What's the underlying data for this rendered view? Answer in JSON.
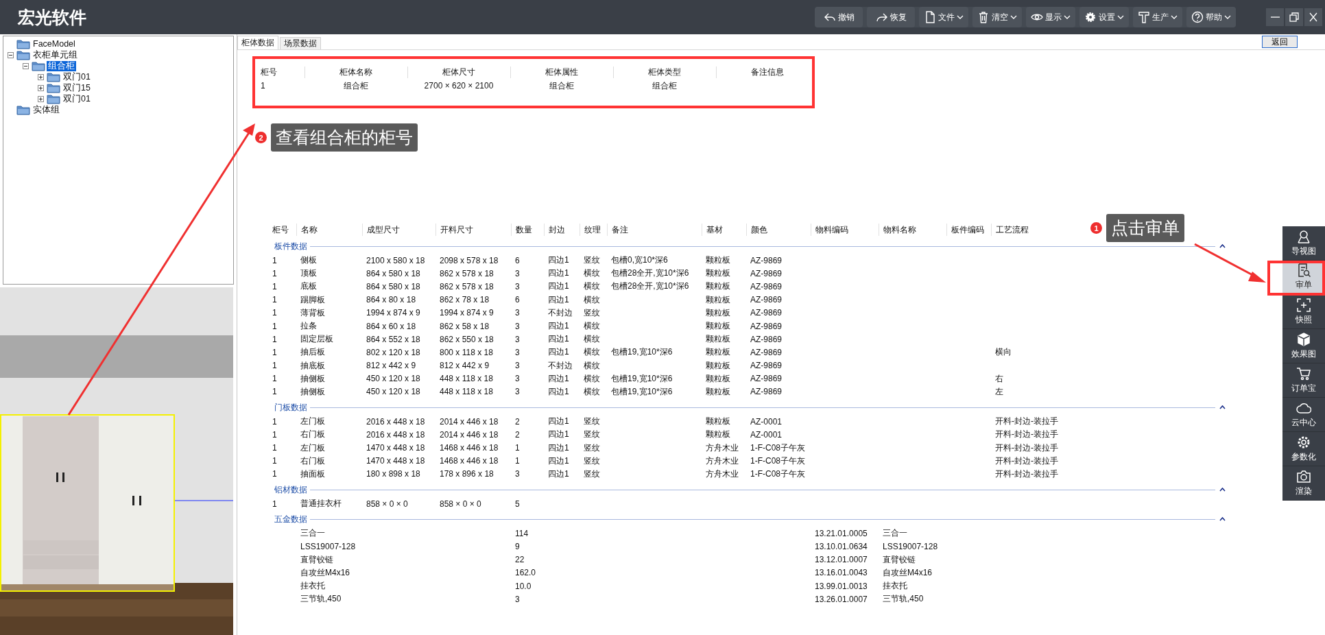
{
  "app_title": "宏光软件",
  "toolbar": [
    {
      "label": "撤销",
      "dropdown": false
    },
    {
      "label": "恢复",
      "dropdown": false
    },
    {
      "label": "文件",
      "dropdown": true
    },
    {
      "label": "清空",
      "dropdown": true
    },
    {
      "label": "显示",
      "dropdown": true
    },
    {
      "label": "设置",
      "dropdown": true
    },
    {
      "label": "生产",
      "dropdown": true
    },
    {
      "label": "帮助",
      "dropdown": true
    }
  ],
  "tree": [
    {
      "label": "FaceModel",
      "selected": false
    },
    {
      "label": "衣柜单元组",
      "selected": false,
      "expanded": true,
      "children": [
        {
          "label": "组合柜",
          "selected": true,
          "expanded": true,
          "children": [
            {
              "label": "双门01",
              "selected": false,
              "expanded": false
            },
            {
              "label": "双门15",
              "selected": false,
              "expanded": false
            },
            {
              "label": "双门01",
              "selected": false,
              "expanded": false
            }
          ]
        }
      ]
    },
    {
      "label": "实体组",
      "selected": false
    }
  ],
  "tabs": [
    {
      "label": "柜体数据",
      "selected": true
    },
    {
      "label": "场景数据",
      "selected": false
    }
  ],
  "back_button": "返回",
  "summary": {
    "columns": [
      "柜号",
      "柜体名称",
      "柜体尺寸",
      "柜体属性",
      "柜体类型",
      "备注信息"
    ],
    "rows": [
      [
        "1",
        "组合柜",
        "2700 × 620 × 2100",
        "组合柜",
        "组合柜"
      ]
    ]
  },
  "detail": {
    "columns": [
      "柜号",
      "名称",
      "成型尺寸",
      "开料尺寸",
      "数量",
      "封边",
      "纹理",
      "备注",
      "基材",
      "颜色",
      "物料编码",
      "物料名称",
      "板件编码",
      "工艺流程"
    ],
    "sections": [
      {
        "title": "板件数据",
        "expanded": true,
        "rows": [
          {
            "cabinet_no": "1",
            "name": "侧板",
            "formed_size": "2100 x 580 x 18",
            "cut_size": "2098 x 578 x 18",
            "qty": "6",
            "edge": "四边1",
            "grain": "竖纹",
            "note": "包槽0,宽10*深6",
            "base": "颗粒板",
            "color_code": "AZ-9869"
          },
          {
            "cabinet_no": "1",
            "name": "顶板",
            "formed_size": "864 x 580 x 18",
            "cut_size": "862 x 578 x 18",
            "qty": "3",
            "edge": "四边1",
            "grain": "横纹",
            "note": "包槽28全开,宽10*深6",
            "base": "颗粒板",
            "color_code": "AZ-9869"
          },
          {
            "cabinet_no": "1",
            "name": "底板",
            "formed_size": "864 x 580 x 18",
            "cut_size": "862 x 578 x 18",
            "qty": "3",
            "edge": "四边1",
            "grain": "横纹",
            "note": "包槽28全开,宽10*深6",
            "base": "颗粒板",
            "color_code": "AZ-9869"
          },
          {
            "cabinet_no": "1",
            "name": "踢脚板",
            "formed_size": "864 x 80 x 18",
            "cut_size": "862 x 78 x 18",
            "qty": "6",
            "edge": "四边1",
            "grain": "横纹",
            "base": "颗粒板",
            "color_code": "AZ-9869"
          },
          {
            "cabinet_no": "1",
            "name": "薄背板",
            "formed_size": "1994 x 874 x 9",
            "cut_size": "1994 x 874 x 9",
            "qty": "3",
            "edge": "不封边",
            "grain": "竖纹",
            "base": "颗粒板",
            "color_code": "AZ-9869"
          },
          {
            "cabinet_no": "1",
            "name": "拉条",
            "formed_size": "864 x 60 x 18",
            "cut_size": "862 x 58 x 18",
            "qty": "3",
            "edge": "四边1",
            "grain": "横纹",
            "base": "颗粒板",
            "color_code": "AZ-9869"
          },
          {
            "cabinet_no": "1",
            "name": "固定层板",
            "formed_size": "864 x 552 x 18",
            "cut_size": "862 x 550 x 18",
            "qty": "3",
            "edge": "四边1",
            "grain": "横纹",
            "base": "颗粒板",
            "color_code": "AZ-9869"
          },
          {
            "cabinet_no": "1",
            "name": "抽后板",
            "formed_size": "802 x 120 x 18",
            "cut_size": "800 x 118 x 18",
            "qty": "3",
            "edge": "四边1",
            "grain": "横纹",
            "note": "包槽19,宽10*深6",
            "base": "颗粒板",
            "color_code": "AZ-9869",
            "process": "横向"
          },
          {
            "cabinet_no": "1",
            "name": "抽底板",
            "formed_size": "812 x 442 x 9",
            "cut_size": "812 x 442 x 9",
            "qty": "3",
            "edge": "不封边",
            "grain": "横纹",
            "base": "颗粒板",
            "color_code": "AZ-9869"
          },
          {
            "cabinet_no": "1",
            "name": "抽侧板",
            "formed_size": "450 x 120 x 18",
            "cut_size": "448 x 118 x 18",
            "qty": "3",
            "edge": "四边1",
            "grain": "横纹",
            "note": "包槽19,宽10*深6",
            "base": "颗粒板",
            "color_code": "AZ-9869",
            "process": "右"
          },
          {
            "cabinet_no": "1",
            "name": "抽侧板",
            "formed_size": "450 x 120 x 18",
            "cut_size": "448 x 118 x 18",
            "qty": "3",
            "edge": "四边1",
            "grain": "横纹",
            "note": "包槽19,宽10*深6",
            "base": "颗粒板",
            "color_code": "AZ-9869",
            "process": "左"
          }
        ]
      },
      {
        "title": "门板数据",
        "expanded": true,
        "rows": [
          {
            "cabinet_no": "1",
            "name": "左门板",
            "formed_size": "2016 x 448 x 18",
            "cut_size": "2014 x 446 x 18",
            "qty": "2",
            "edge": "四边1",
            "grain": "竖纹",
            "base": "颗粒板",
            "color_code": "AZ-0001",
            "process": "开料-封边-装拉手"
          },
          {
            "cabinet_no": "1",
            "name": "右门板",
            "formed_size": "2016 x 448 x 18",
            "cut_size": "2014 x 446 x 18",
            "qty": "2",
            "edge": "四边1",
            "grain": "竖纹",
            "base": "颗粒板",
            "color_code": "AZ-0001",
            "process": "开料-封边-装拉手"
          },
          {
            "cabinet_no": "1",
            "name": "左门板",
            "formed_size": "1470 x 448 x 18",
            "cut_size": "1468 x 446 x 18",
            "qty": "1",
            "edge": "四边1",
            "grain": "竖纹",
            "base": "方舟木业",
            "color_code": "1-F-C08子午灰",
            "process": "开料-封边-装拉手"
          },
          {
            "cabinet_no": "1",
            "name": "右门板",
            "formed_size": "1470 x 448 x 18",
            "cut_size": "1468 x 446 x 18",
            "qty": "1",
            "edge": "四边1",
            "grain": "竖纹",
            "base": "方舟木业",
            "color_code": "1-F-C08子午灰",
            "process": "开料-封边-装拉手"
          },
          {
            "cabinet_no": "1",
            "name": "抽面板",
            "formed_size": "180 x 898 x 18",
            "cut_size": "178 x 896 x 18",
            "qty": "3",
            "edge": "四边1",
            "grain": "竖纹",
            "base": "方舟木业",
            "color_code": "1-F-C08子午灰",
            "process": "开料-封边-装拉手"
          }
        ]
      },
      {
        "title": "铝材数据",
        "expanded": true,
        "rows": [
          {
            "cabinet_no": "1",
            "name": "普通挂衣杆",
            "formed_size": "858 × 0 × 0",
            "cut_size": "858 × 0 × 0",
            "qty": "5"
          }
        ]
      },
      {
        "title": "五金数据",
        "expanded": true,
        "rows": [
          {
            "name": "三合一",
            "qty": "114",
            "material_code": "13.21.01.0005",
            "material_name": "三合一"
          },
          {
            "name": "LSS19007-128",
            "qty": "9",
            "material_code": "13.10.01.0634",
            "material_name": "LSS19007-128"
          },
          {
            "name": "直臂铰链",
            "qty": "22",
            "material_code": "13.12.01.0007",
            "material_name": "直臂铰链"
          },
          {
            "name": "自攻丝M4x16",
            "qty": "162.0",
            "material_code": "13.16.01.0043",
            "material_name": "自攻丝M4x16"
          },
          {
            "name": "挂衣托",
            "qty": "10.0",
            "material_code": "13.99.01.0013",
            "material_name": "挂衣托"
          },
          {
            "name": "三节轨,450",
            "qty": "3",
            "material_code": "13.26.01.0007",
            "material_name": "三节轨,450"
          }
        ]
      }
    ]
  },
  "sidebar": [
    {
      "label": "导视图",
      "selected": false
    },
    {
      "label": "审单",
      "selected": true
    },
    {
      "label": "快照",
      "selected": false
    },
    {
      "label": "效果图",
      "selected": false
    },
    {
      "label": "订单宝",
      "selected": false
    },
    {
      "label": "云中心",
      "selected": false
    },
    {
      "label": "参数化",
      "selected": false
    },
    {
      "label": "渲染",
      "selected": false
    }
  ],
  "annotations": [
    {
      "number": "2",
      "text": "查看组合柜的柜号"
    },
    {
      "number": "1",
      "text": "点击审单"
    }
  ]
}
